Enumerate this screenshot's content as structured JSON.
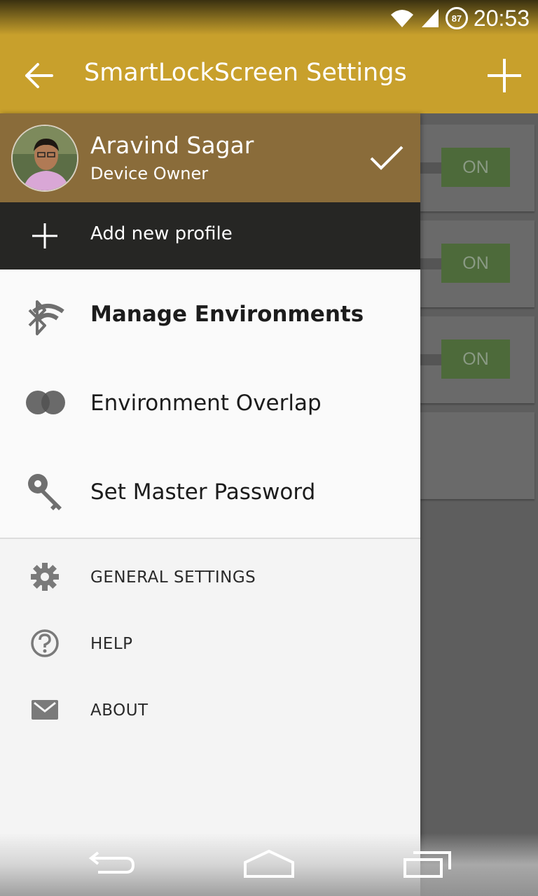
{
  "status_bar": {
    "time": "20:53",
    "battery": "87"
  },
  "app_bar": {
    "title": "SmartLockScreen Settings"
  },
  "background": {
    "toggles": [
      "ON",
      "ON",
      "ON"
    ]
  },
  "drawer": {
    "profile": {
      "name": "Aravind Sagar",
      "role": "Device Owner"
    },
    "add_profile": {
      "label": "Add new profile"
    },
    "primary_items": [
      {
        "label": "Manage Environments",
        "icon": "bluetooth-wifi-icon"
      },
      {
        "label": "Environment Overlap",
        "icon": "overlap-circles-icon"
      },
      {
        "label": "Set Master Password",
        "icon": "key-icon"
      }
    ],
    "secondary_items": [
      {
        "label": "GENERAL SETTINGS",
        "icon": "gear-icon"
      },
      {
        "label": "HELP",
        "icon": "help-icon"
      },
      {
        "label": "ABOUT",
        "icon": "mail-icon"
      }
    ]
  },
  "colors": {
    "app_bar": "#c8a02c",
    "profile_header": "#8a6c3a",
    "add_profile_bg": "#262624",
    "toggle_on": "#4d6a3a"
  }
}
